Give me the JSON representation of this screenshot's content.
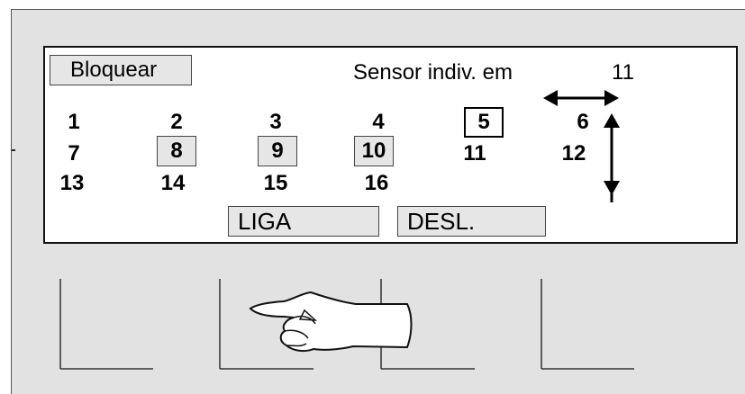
{
  "screen": {
    "lock_button": "Bloquear",
    "sensor_label": "Sensor indiv. em",
    "sensor_value": "11",
    "sensors": [
      {
        "label": "1",
        "state": "normal"
      },
      {
        "label": "2",
        "state": "normal"
      },
      {
        "label": "3",
        "state": "normal"
      },
      {
        "label": "4",
        "state": "normal"
      },
      {
        "label": "5",
        "state": "current"
      },
      {
        "label": "6",
        "state": "normal"
      },
      {
        "label": "7",
        "state": "normal"
      },
      {
        "label": "8",
        "state": "selected"
      },
      {
        "label": "9",
        "state": "selected"
      },
      {
        "label": "10",
        "state": "selected"
      },
      {
        "label": "11",
        "state": "normal"
      },
      {
        "label": "12",
        "state": "normal"
      },
      {
        "label": "13",
        "state": "normal"
      },
      {
        "label": "14",
        "state": "normal"
      },
      {
        "label": "15",
        "state": "normal"
      },
      {
        "label": "16",
        "state": "normal"
      }
    ],
    "on_button": "LIGA",
    "off_button": "DESL."
  },
  "icons": {
    "horizontal": "left-right-arrow-icon",
    "vertical": "up-down-arrow-icon",
    "hand": "pointing-hand-icon"
  },
  "colors": {
    "panel": "#e2e2e2",
    "screen": "#ffffff",
    "button": "#e6e6e6"
  }
}
